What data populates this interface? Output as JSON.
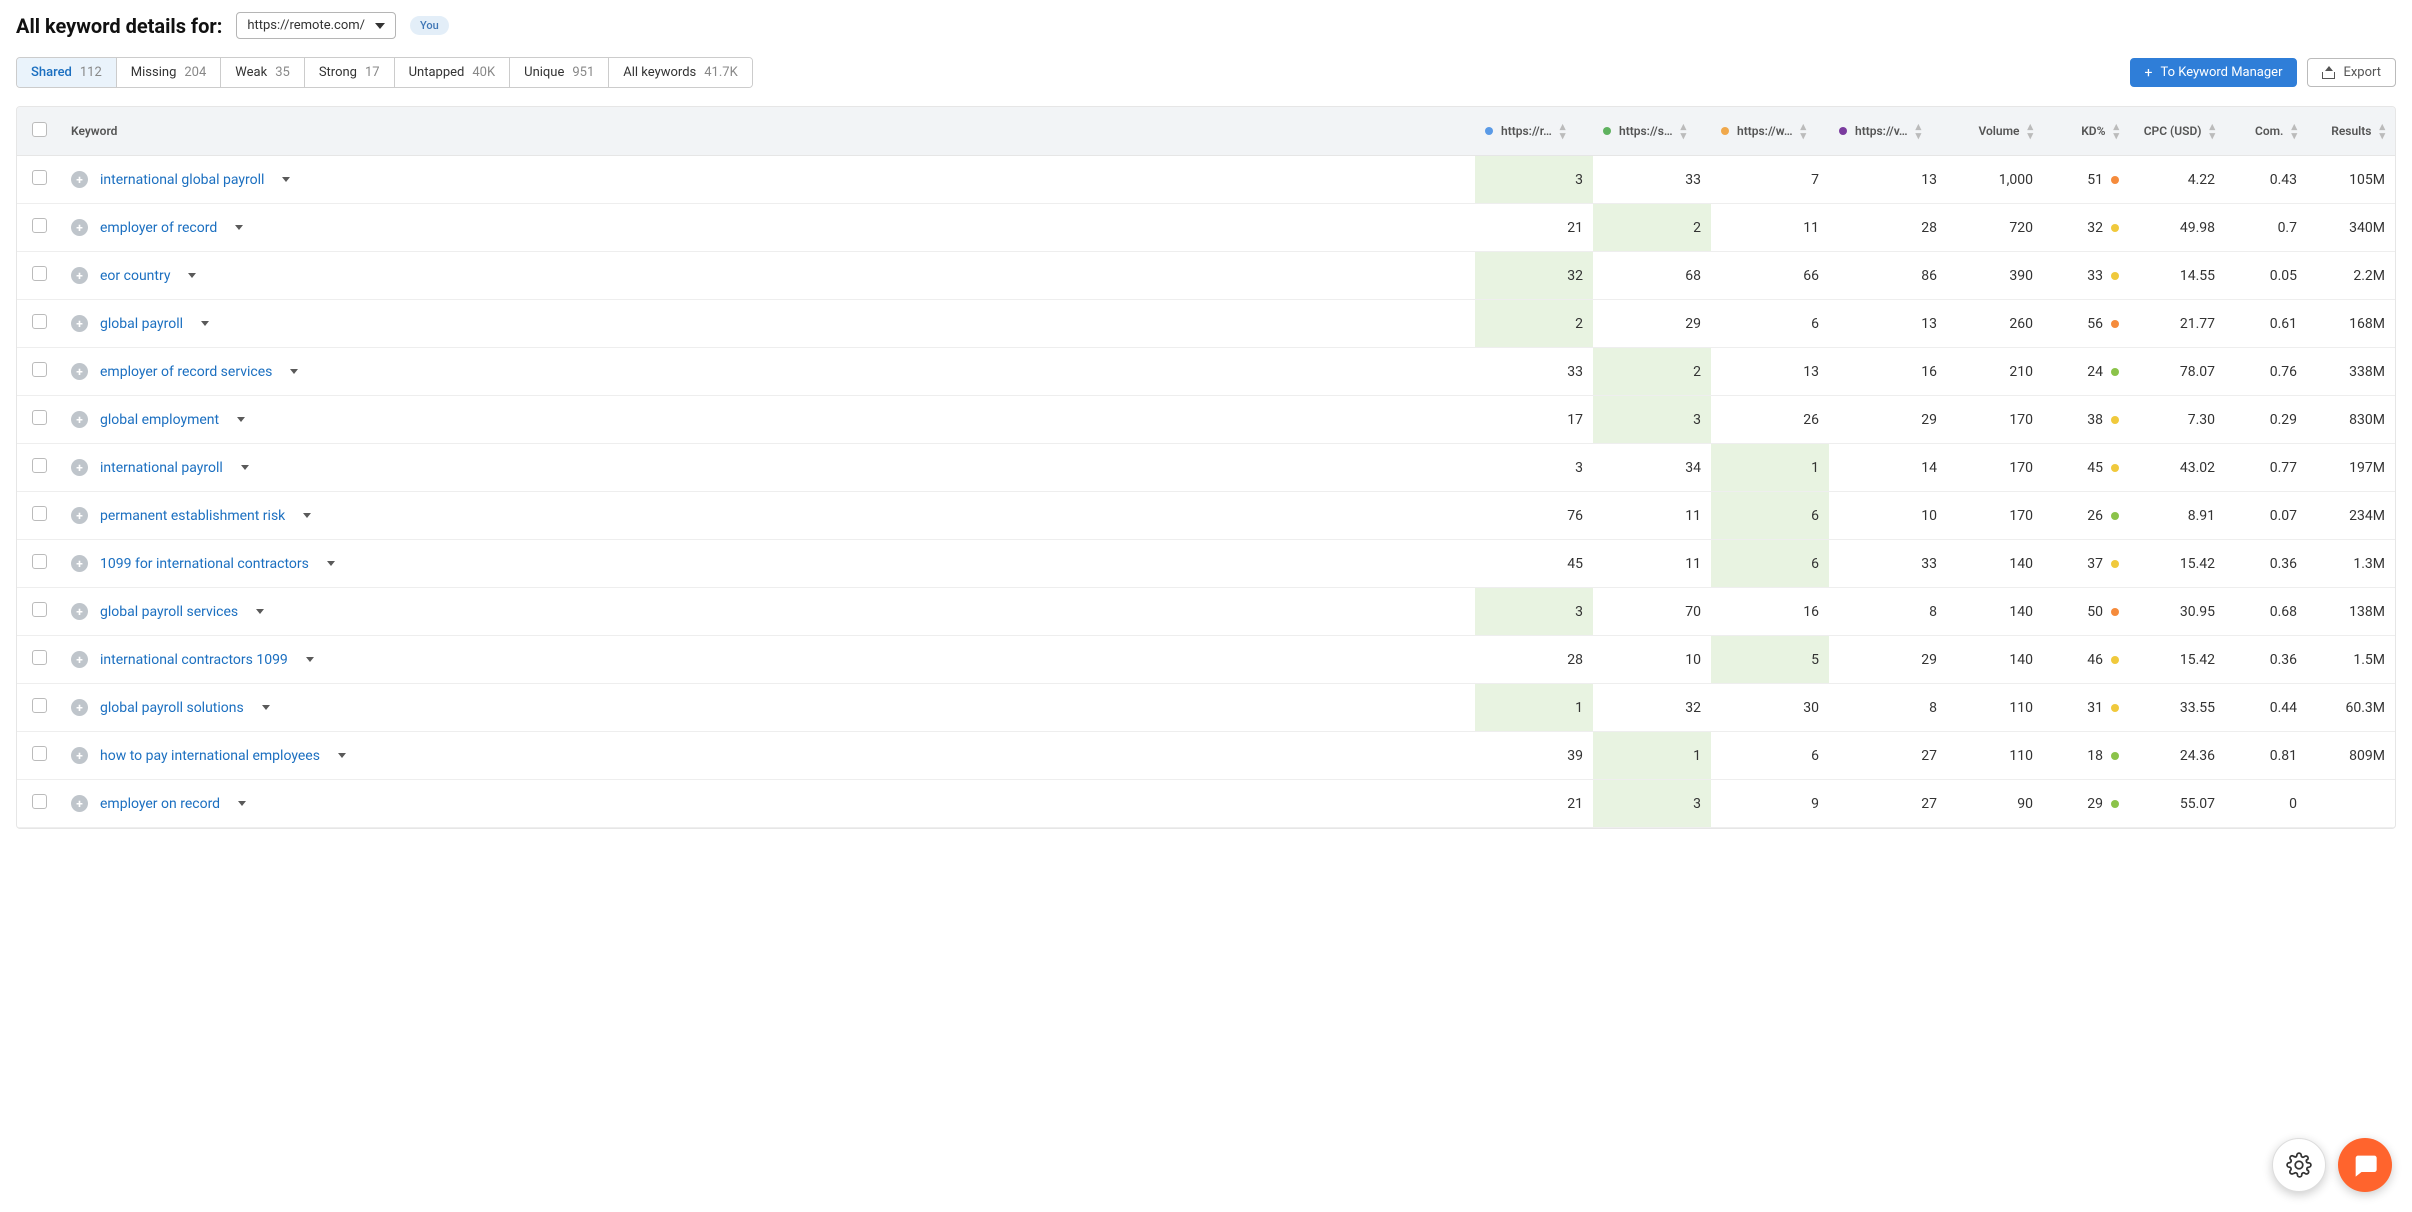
{
  "header": {
    "title": "All keyword details for:",
    "domain": "https://remote.com/",
    "you_label": "You"
  },
  "tabs": [
    {
      "label": "Shared",
      "count": "112",
      "active": true
    },
    {
      "label": "Missing",
      "count": "204",
      "active": false
    },
    {
      "label": "Weak",
      "count": "35",
      "active": false
    },
    {
      "label": "Strong",
      "count": "17",
      "active": false
    },
    {
      "label": "Untapped",
      "count": "40K",
      "active": false
    },
    {
      "label": "Unique",
      "count": "951",
      "active": false
    },
    {
      "label": "All keywords",
      "count": "41.7K",
      "active": false
    }
  ],
  "buttons": {
    "keyword_manager": "To Keyword Manager",
    "export": "Export"
  },
  "columns": {
    "keyword": "Keyword",
    "competitors": [
      {
        "label": "https://r…",
        "color": "#5a9ae6"
      },
      {
        "label": "https://s…",
        "color": "#5fb25f"
      },
      {
        "label": "https://w…",
        "color": "#f0a84b"
      },
      {
        "label": "https://v…",
        "color": "#7a3b9e"
      }
    ],
    "volume": "Volume",
    "kd": "KD%",
    "cpc": "CPC (USD)",
    "com": "Com.",
    "results": "Results"
  },
  "kd_colors": {
    "orange": "#f58b3c",
    "yellow": "#f0c93c",
    "green": "#8bc34a"
  },
  "rows": [
    {
      "keyword": "international global payroll",
      "comps": [
        "3",
        "33",
        "7",
        "13"
      ],
      "hl": 0,
      "volume": "1,000",
      "kd": "51",
      "kd_color": "orange",
      "cpc": "4.22",
      "com": "0.43",
      "results": "105M"
    },
    {
      "keyword": "employer of record",
      "comps": [
        "21",
        "2",
        "11",
        "28"
      ],
      "hl": 1,
      "volume": "720",
      "kd": "32",
      "kd_color": "yellow",
      "cpc": "49.98",
      "com": "0.7",
      "results": "340M"
    },
    {
      "keyword": "eor country",
      "comps": [
        "32",
        "68",
        "66",
        "86"
      ],
      "hl": 0,
      "volume": "390",
      "kd": "33",
      "kd_color": "yellow",
      "cpc": "14.55",
      "com": "0.05",
      "results": "2.2M"
    },
    {
      "keyword": "global payroll",
      "comps": [
        "2",
        "29",
        "6",
        "13"
      ],
      "hl": 0,
      "volume": "260",
      "kd": "56",
      "kd_color": "orange",
      "cpc": "21.77",
      "com": "0.61",
      "results": "168M"
    },
    {
      "keyword": "employer of record services",
      "comps": [
        "33",
        "2",
        "13",
        "16"
      ],
      "hl": 1,
      "volume": "210",
      "kd": "24",
      "kd_color": "green",
      "cpc": "78.07",
      "com": "0.76",
      "results": "338M"
    },
    {
      "keyword": "global employment",
      "comps": [
        "17",
        "3",
        "26",
        "29"
      ],
      "hl": 1,
      "volume": "170",
      "kd": "38",
      "kd_color": "yellow",
      "cpc": "7.30",
      "com": "0.29",
      "results": "830M"
    },
    {
      "keyword": "international payroll",
      "comps": [
        "3",
        "34",
        "1",
        "14"
      ],
      "hl": 2,
      "volume": "170",
      "kd": "45",
      "kd_color": "yellow",
      "cpc": "43.02",
      "com": "0.77",
      "results": "197M"
    },
    {
      "keyword": "permanent establishment risk",
      "comps": [
        "76",
        "11",
        "6",
        "10"
      ],
      "hl": 2,
      "volume": "170",
      "kd": "26",
      "kd_color": "green",
      "cpc": "8.91",
      "com": "0.07",
      "results": "234M"
    },
    {
      "keyword": "1099 for international contractors",
      "comps": [
        "45",
        "11",
        "6",
        "33"
      ],
      "hl": 2,
      "volume": "140",
      "kd": "37",
      "kd_color": "yellow",
      "cpc": "15.42",
      "com": "0.36",
      "results": "1.3M"
    },
    {
      "keyword": "global payroll services",
      "comps": [
        "3",
        "70",
        "16",
        "8"
      ],
      "hl": 0,
      "volume": "140",
      "kd": "50",
      "kd_color": "orange",
      "cpc": "30.95",
      "com": "0.68",
      "results": "138M"
    },
    {
      "keyword": "international contractors 1099",
      "comps": [
        "28",
        "10",
        "5",
        "29"
      ],
      "hl": 2,
      "volume": "140",
      "kd": "46",
      "kd_color": "yellow",
      "cpc": "15.42",
      "com": "0.36",
      "results": "1.5M"
    },
    {
      "keyword": "global payroll solutions",
      "comps": [
        "1",
        "32",
        "30",
        "8"
      ],
      "hl": 0,
      "volume": "110",
      "kd": "31",
      "kd_color": "yellow",
      "cpc": "33.55",
      "com": "0.44",
      "results": "60.3M"
    },
    {
      "keyword": "how to pay international employees",
      "comps": [
        "39",
        "1",
        "6",
        "27"
      ],
      "hl": 1,
      "volume": "110",
      "kd": "18",
      "kd_color": "green",
      "cpc": "24.36",
      "com": "0.81",
      "results": "809M"
    },
    {
      "keyword": "employer on record",
      "comps": [
        "21",
        "3",
        "9",
        "27"
      ],
      "hl": 1,
      "volume": "90",
      "kd": "29",
      "kd_color": "green",
      "cpc": "55.07",
      "com": "0",
      "results": ""
    }
  ]
}
